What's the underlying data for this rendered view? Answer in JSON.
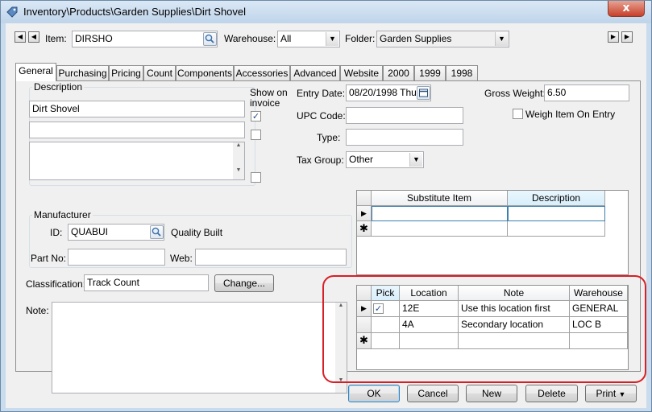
{
  "window": {
    "title": "Inventory\\Products\\Garden Supplies\\Dirt Shovel",
    "close_label": "x"
  },
  "header": {
    "item_label": "Item:",
    "item_value": "DIRSHO",
    "warehouse_label": "Warehouse:",
    "warehouse_value": "All",
    "folder_label": "Folder:",
    "folder_value": "Garden Supplies"
  },
  "tabs": [
    {
      "label": "General",
      "active": true
    },
    {
      "label": "Purchasing"
    },
    {
      "label": "Pricing"
    },
    {
      "label": "Count"
    },
    {
      "label": "Components"
    },
    {
      "label": "Accessories"
    },
    {
      "label": "Advanced"
    },
    {
      "label": "Website"
    },
    {
      "label": "2000"
    },
    {
      "label": "1999"
    },
    {
      "label": "1998"
    }
  ],
  "general": {
    "description_label": "Description",
    "description_value": "Dirt Shovel",
    "show_on_invoice_label": "Show on\ninvoice",
    "entry_date_label": "Entry Date:",
    "entry_date_value": "08/20/1998 Thu",
    "upc_label": "UPC Code:",
    "type_label": "Type:",
    "tax_group_label": "Tax Group:",
    "tax_group_value": "Other",
    "gross_weight_label": "Gross Weight:",
    "gross_weight_value": "6.50",
    "weigh_on_entry_label": "Weigh Item On Entry",
    "manufacturer_label": "Manufacturer",
    "mfr_id_label": "ID:",
    "mfr_id_value": "QUABUI",
    "mfr_name": "Quality Built",
    "part_no_label": "Part No:",
    "web_label": "Web:",
    "classification_label": "Classification:",
    "classification_value": "Track Count",
    "change_button": "Change...",
    "note_label": "Note:"
  },
  "substitute_grid": {
    "columns": [
      "Substitute Item",
      "Description"
    ]
  },
  "location_grid": {
    "columns": [
      "Pick",
      "Location",
      "Note",
      "Warehouse"
    ],
    "rows": [
      {
        "pick": true,
        "location": "12E",
        "note": "Use this location first",
        "warehouse": "GENERAL"
      },
      {
        "pick": false,
        "location": "4A",
        "note": "Secondary location",
        "warehouse": "LOC B"
      }
    ]
  },
  "footer": {
    "ok": "OK",
    "cancel": "Cancel",
    "new": "New",
    "delete": "Delete",
    "print": "Print"
  },
  "colors": {
    "highlight_ring": "#d71f26",
    "title_bar": "#c9dced"
  }
}
